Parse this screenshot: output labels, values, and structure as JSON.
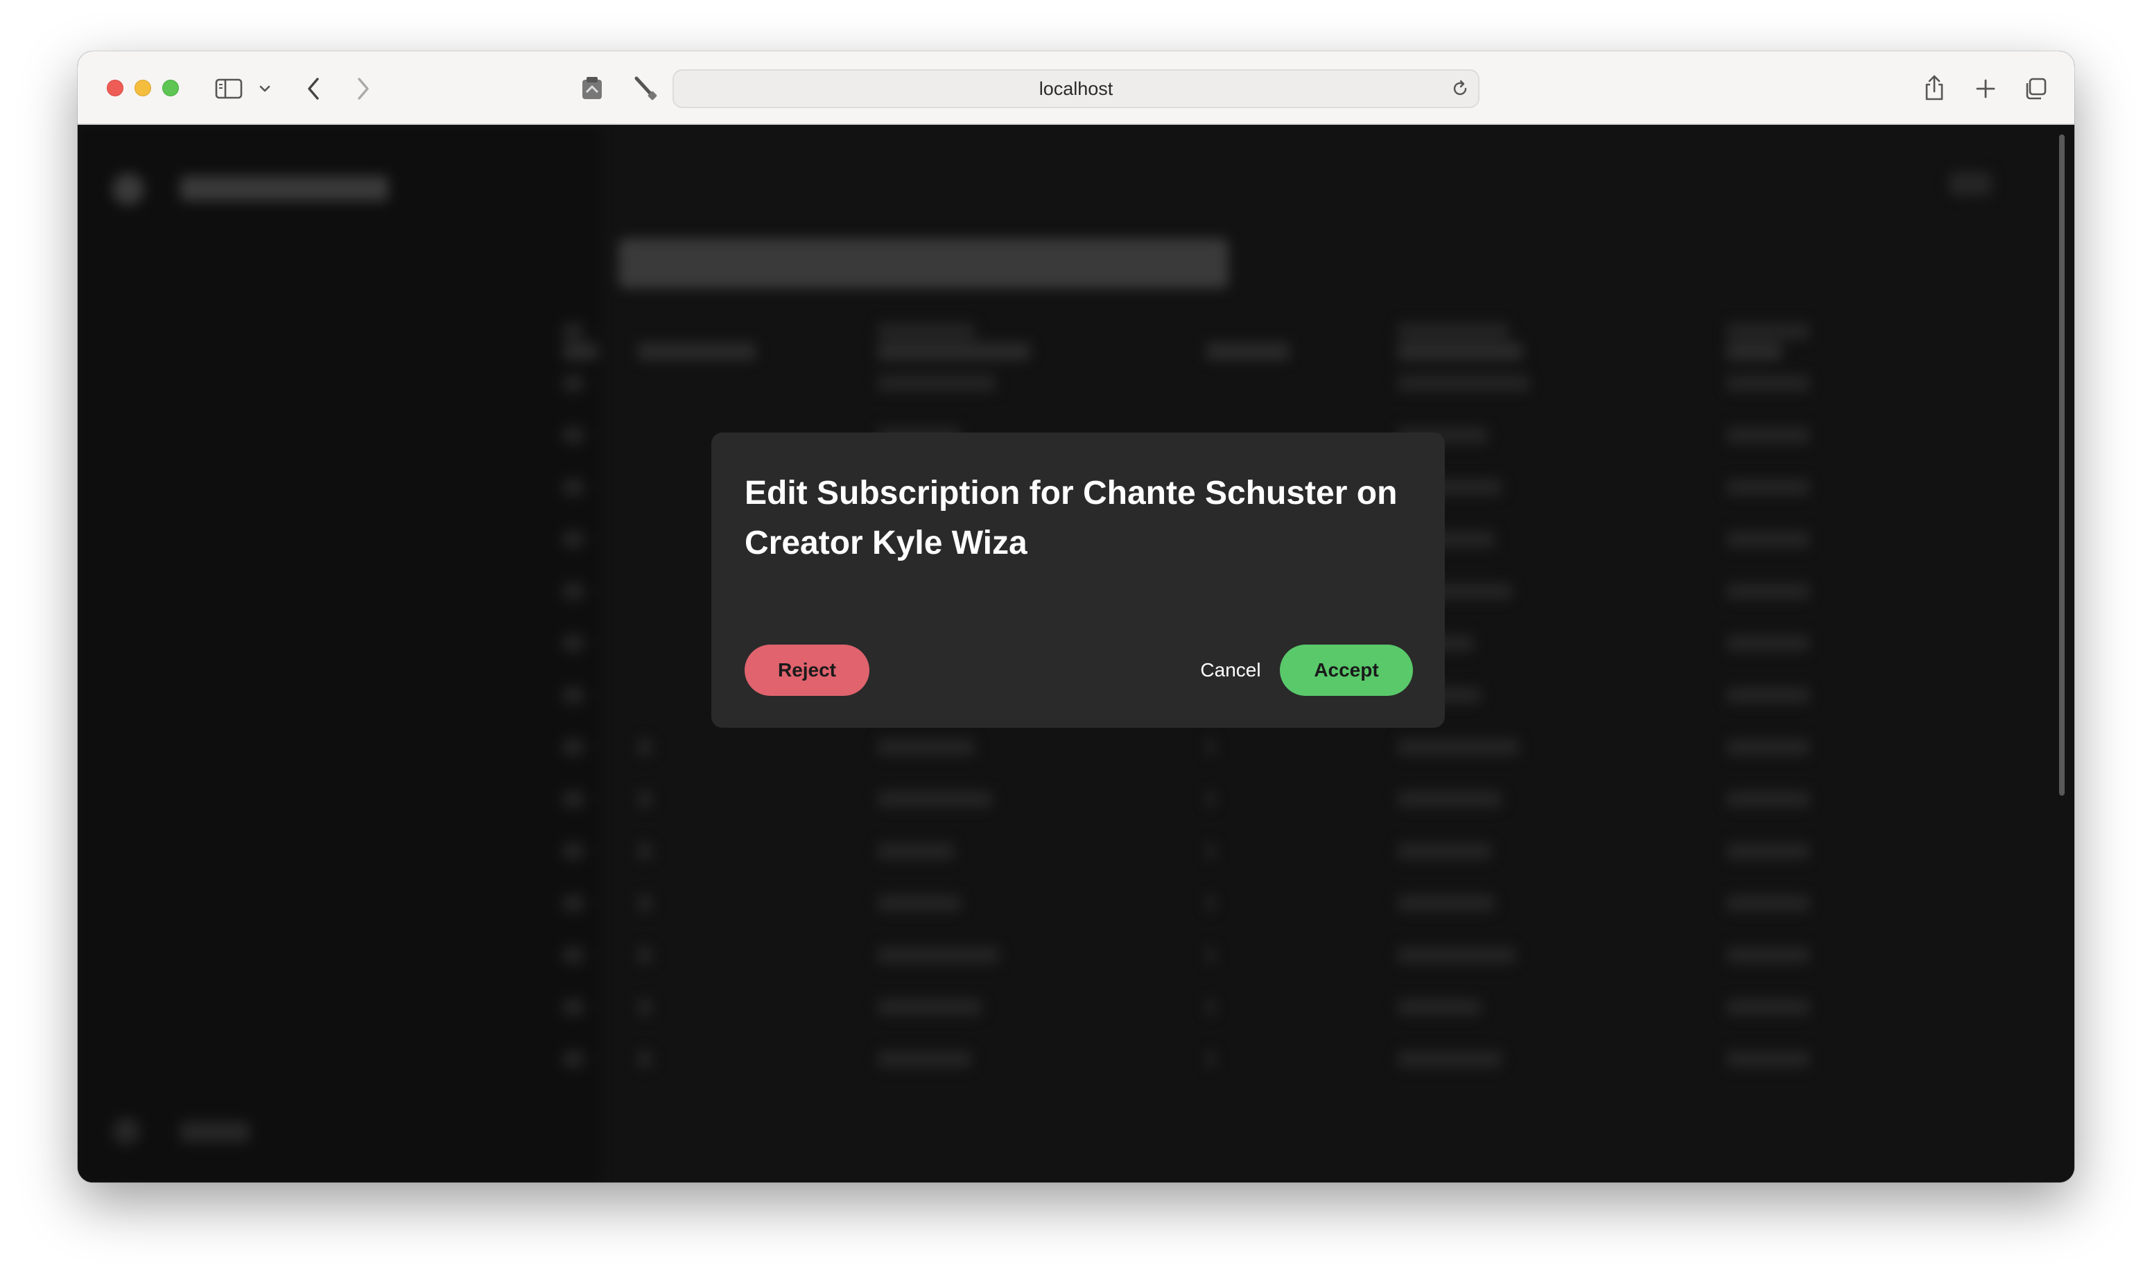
{
  "browser": {
    "url": "localhost"
  },
  "modal": {
    "title": "Edit Subscription for Chante Schuster on Creator Kyle Wiza",
    "reject_label": "Reject",
    "cancel_label": "Cancel",
    "accept_label": "Accept"
  },
  "colors": {
    "reject": "#e0636e",
    "accept": "#59c96a",
    "modal_bg": "#2a2a2a",
    "page_bg": "#121212"
  }
}
